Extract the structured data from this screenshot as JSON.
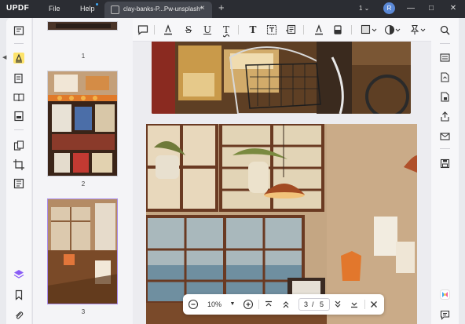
{
  "app": {
    "logo": "UPDF"
  },
  "menu": {
    "file": "File",
    "help": "Help"
  },
  "tab": {
    "title": "clay-banks-P...Pw-unsplash*",
    "close": "×",
    "add": "+"
  },
  "titlebar": {
    "window_count": "1",
    "user_initial": "R",
    "minimize": "—",
    "maximize": "□",
    "close": "✕"
  },
  "toolbar": {
    "strike": "S",
    "underline": "U",
    "text": "T"
  },
  "thumbnails": [
    {
      "number": "1"
    },
    {
      "number": "2"
    },
    {
      "number": "3"
    }
  ],
  "zoom": {
    "value": "10%",
    "current_page": "3",
    "separator": "/",
    "total_pages": "5"
  },
  "colors": {
    "accent": "#8a5cf6",
    "titlebar": "#2b2d33",
    "avatar": "#5a88d6"
  }
}
